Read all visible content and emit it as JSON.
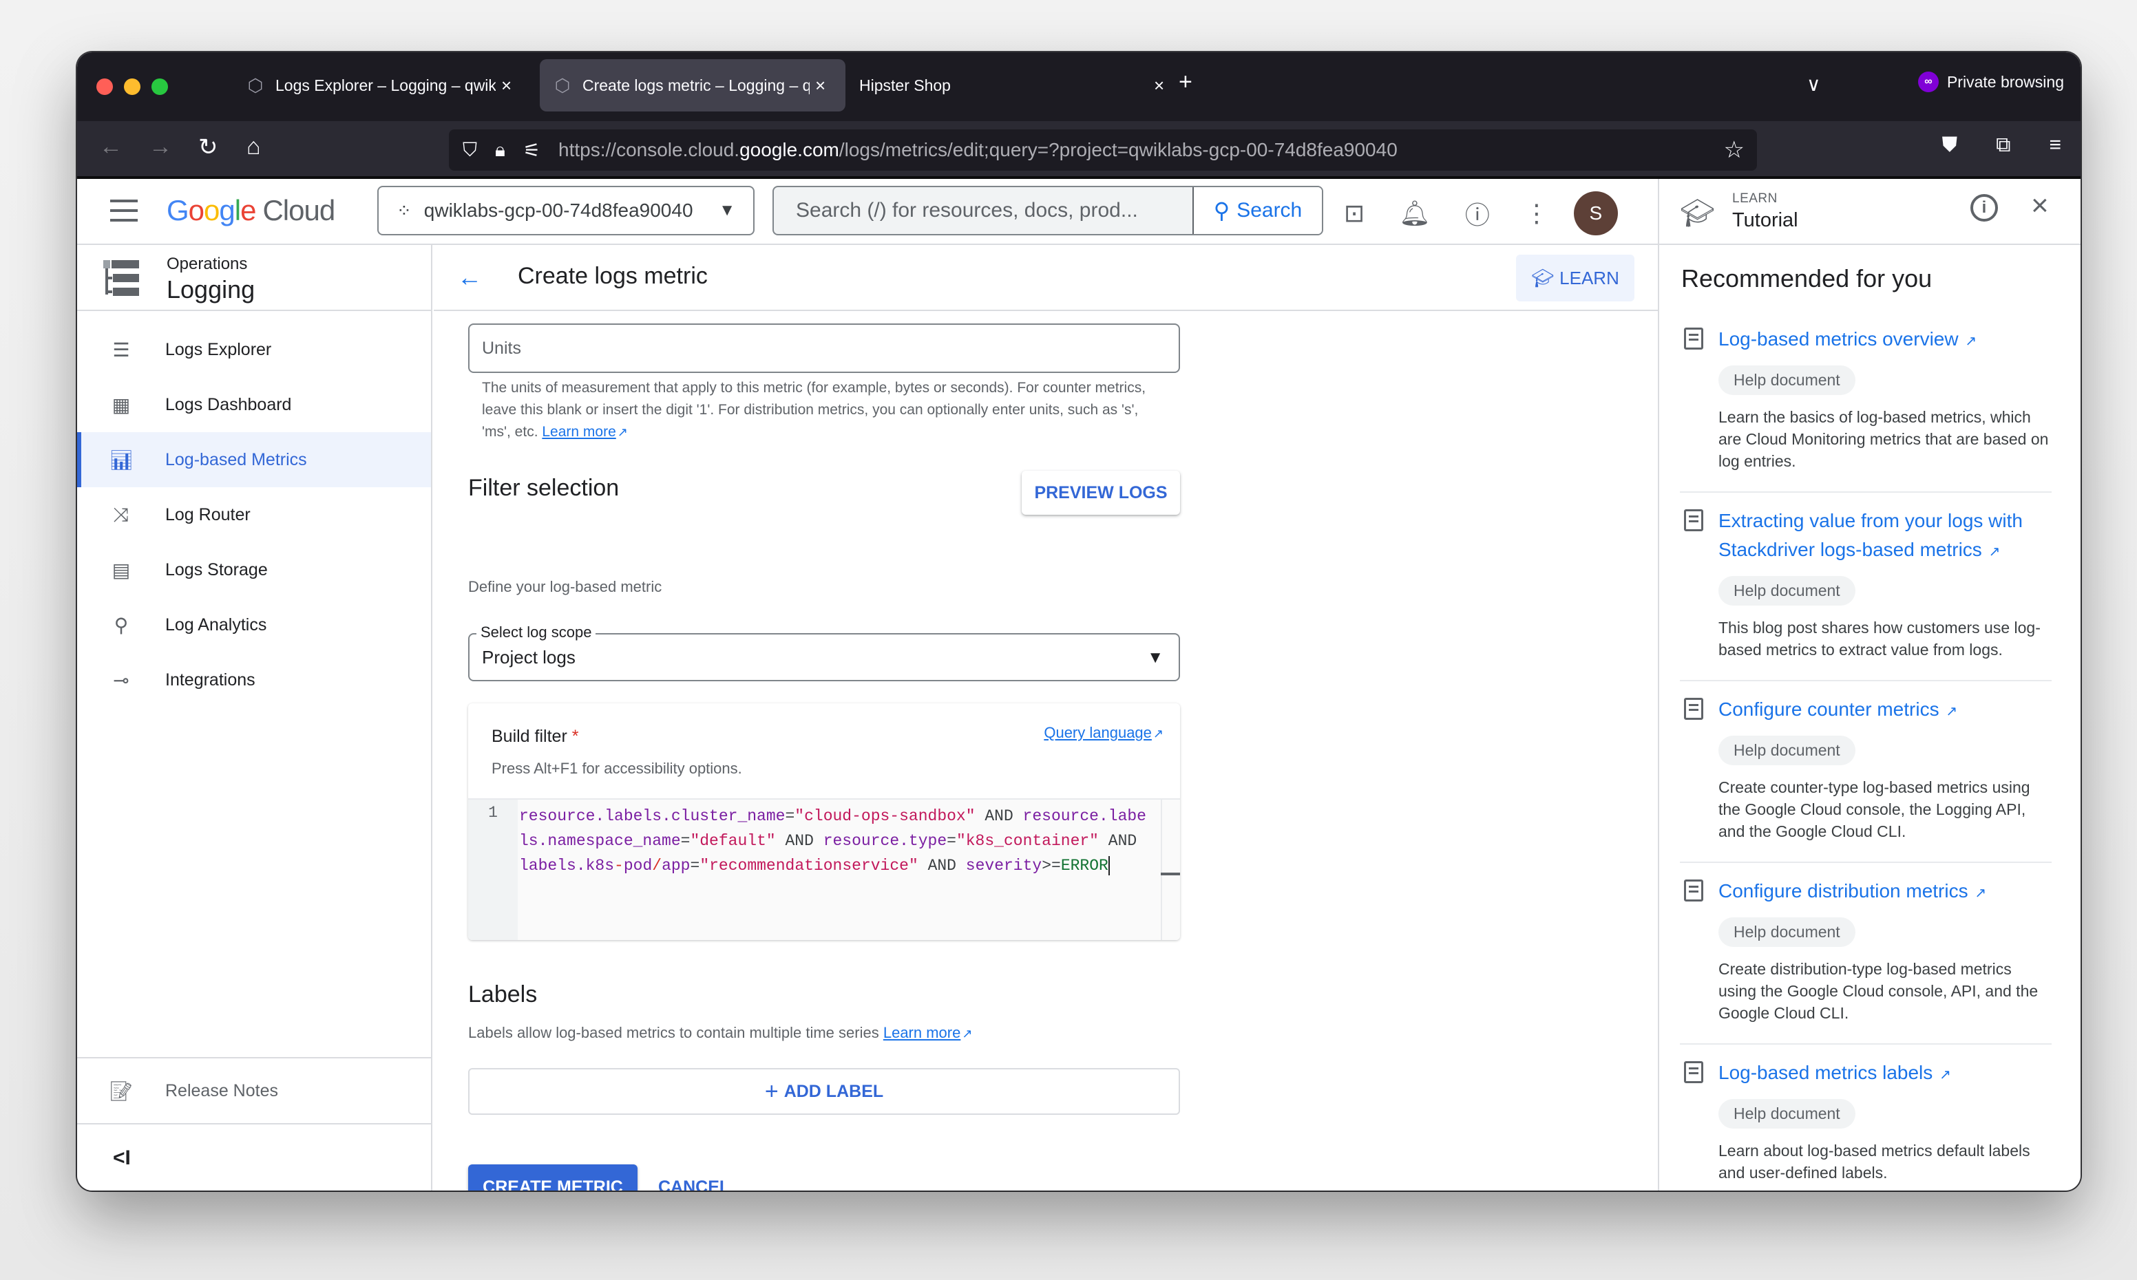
{
  "browser": {
    "tabs": [
      {
        "title": "Logs Explorer – Logging – qwiklabs",
        "active": false
      },
      {
        "title": "Create logs metric – Logging – qwiklabs",
        "active": true
      },
      {
        "title": "Hipster Shop",
        "active": false
      }
    ],
    "new_tab": "+",
    "tab_list": "∨",
    "private_label": "Private browsing",
    "url_prefix": "https://console.cloud.",
    "url_domain": "google.com",
    "url_path": "/logs/metrics/edit;query=?project=qwiklabs-gcp-00-74d8fea90040"
  },
  "header": {
    "logo_cloud": "Cloud",
    "project": "qwiklabs-gcp-00-74d8fea90040",
    "search_placeholder": "Search (/) for resources, docs, prod...",
    "search_button": "Search",
    "avatar_initial": "S"
  },
  "sidebar": {
    "product_group": "Operations",
    "product_name": "Logging",
    "items": [
      {
        "label": "Logs Explorer",
        "icon": "list-icon",
        "active": false
      },
      {
        "label": "Logs Dashboard",
        "icon": "dashboard-icon",
        "active": false
      },
      {
        "label": "Log-based Metrics",
        "icon": "bar-chart-icon",
        "active": true
      },
      {
        "label": "Log Router",
        "icon": "shuffle-icon",
        "active": false
      },
      {
        "label": "Logs Storage",
        "icon": "storage-icon",
        "active": false
      },
      {
        "label": "Log Analytics",
        "icon": "search-list-icon",
        "active": false
      },
      {
        "label": "Integrations",
        "icon": "integrations-icon",
        "active": false
      }
    ],
    "release_notes": "Release Notes",
    "collapse": "<I"
  },
  "page": {
    "title": "Create logs metric",
    "learn_button": "LEARN"
  },
  "form": {
    "units_placeholder": "Units",
    "units_help": "The units of measurement that apply to this metric (for example, bytes or seconds). For counter metrics, leave this blank or insert the digit '1'. For distribution metrics, you can optionally enter units, such as 's', 'ms', etc.",
    "learn_more": "Learn more",
    "filter_heading": "Filter selection",
    "preview_logs": "PREVIEW LOGS",
    "filter_subtitle": "Define your log-based metric",
    "scope_label": "Select log scope",
    "scope_value": "Project logs",
    "build_filter_label": "Build filter",
    "required_mark": "*",
    "query_language": "Query language",
    "a11y_hint": "Press Alt+F1 for accessibility options.",
    "line_number": "1",
    "query": [
      {
        "t": "k",
        "v": "resource.labels.cluster_name"
      },
      {
        "t": "o",
        "v": "="
      },
      {
        "t": "s",
        "v": "\"cloud-ops-sandbox\""
      },
      {
        "t": "o",
        "v": " AND "
      },
      {
        "t": "k",
        "v": "resource.labels.namespace_name"
      },
      {
        "t": "o",
        "v": "="
      },
      {
        "t": "s",
        "v": "\"default\""
      },
      {
        "t": "o",
        "v": " AND "
      },
      {
        "t": "k",
        "v": "resource.type"
      },
      {
        "t": "o",
        "v": "="
      },
      {
        "t": "s",
        "v": "\"k8s_container\""
      },
      {
        "t": "o",
        "v": " AND "
      },
      {
        "t": "k",
        "v": "labels.k8s"
      },
      {
        "t": "r",
        "v": "-"
      },
      {
        "t": "k",
        "v": "pod"
      },
      {
        "t": "r",
        "v": "/"
      },
      {
        "t": "k",
        "v": "app"
      },
      {
        "t": "o",
        "v": "="
      },
      {
        "t": "s",
        "v": "\"recommendationservice\""
      },
      {
        "t": "o",
        "v": " AND "
      },
      {
        "t": "k",
        "v": "severity"
      },
      {
        "t": "o",
        "v": ">="
      },
      {
        "t": "e",
        "v": "ERROR"
      }
    ],
    "labels_heading": "Labels",
    "labels_help": "Labels allow log-based metrics to contain multiple time series",
    "add_label": "ADD LABEL",
    "create_metric": "CREATE METRIC",
    "cancel": "CANCEL"
  },
  "tutorial": {
    "eyebrow": "LEARN",
    "title": "Tutorial",
    "recommended_heading": "Recommended for you",
    "cards": [
      {
        "title": "Log-based metrics overview",
        "chip": "Help document",
        "desc": "Learn the basics of log-based metrics, which are Cloud Monitoring metrics that are based on log entries."
      },
      {
        "title": "Extracting value from your logs with Stackdriver logs-based metrics",
        "chip": "Help document",
        "desc": "This blog post shares how customers use log-based metrics to extract value from logs."
      },
      {
        "title": "Configure counter metrics",
        "chip": "Help document",
        "desc": "Create counter-type log-based metrics using the Google Cloud console, the Logging API, and the Google Cloud CLI."
      },
      {
        "title": "Configure distribution metrics",
        "chip": "Help document",
        "desc": "Create distribution-type log-based metrics using the Google Cloud console, API, and the Google Cloud CLI."
      },
      {
        "title": "Log-based metrics labels",
        "chip": "Help document",
        "desc": "Learn about log-based metrics default labels and user-defined labels."
      }
    ]
  },
  "colors": {
    "accent": "#3367d6",
    "link": "#1a73e8",
    "active_bg": "#eef3fd",
    "browser_chrome": "#1c1b22"
  }
}
